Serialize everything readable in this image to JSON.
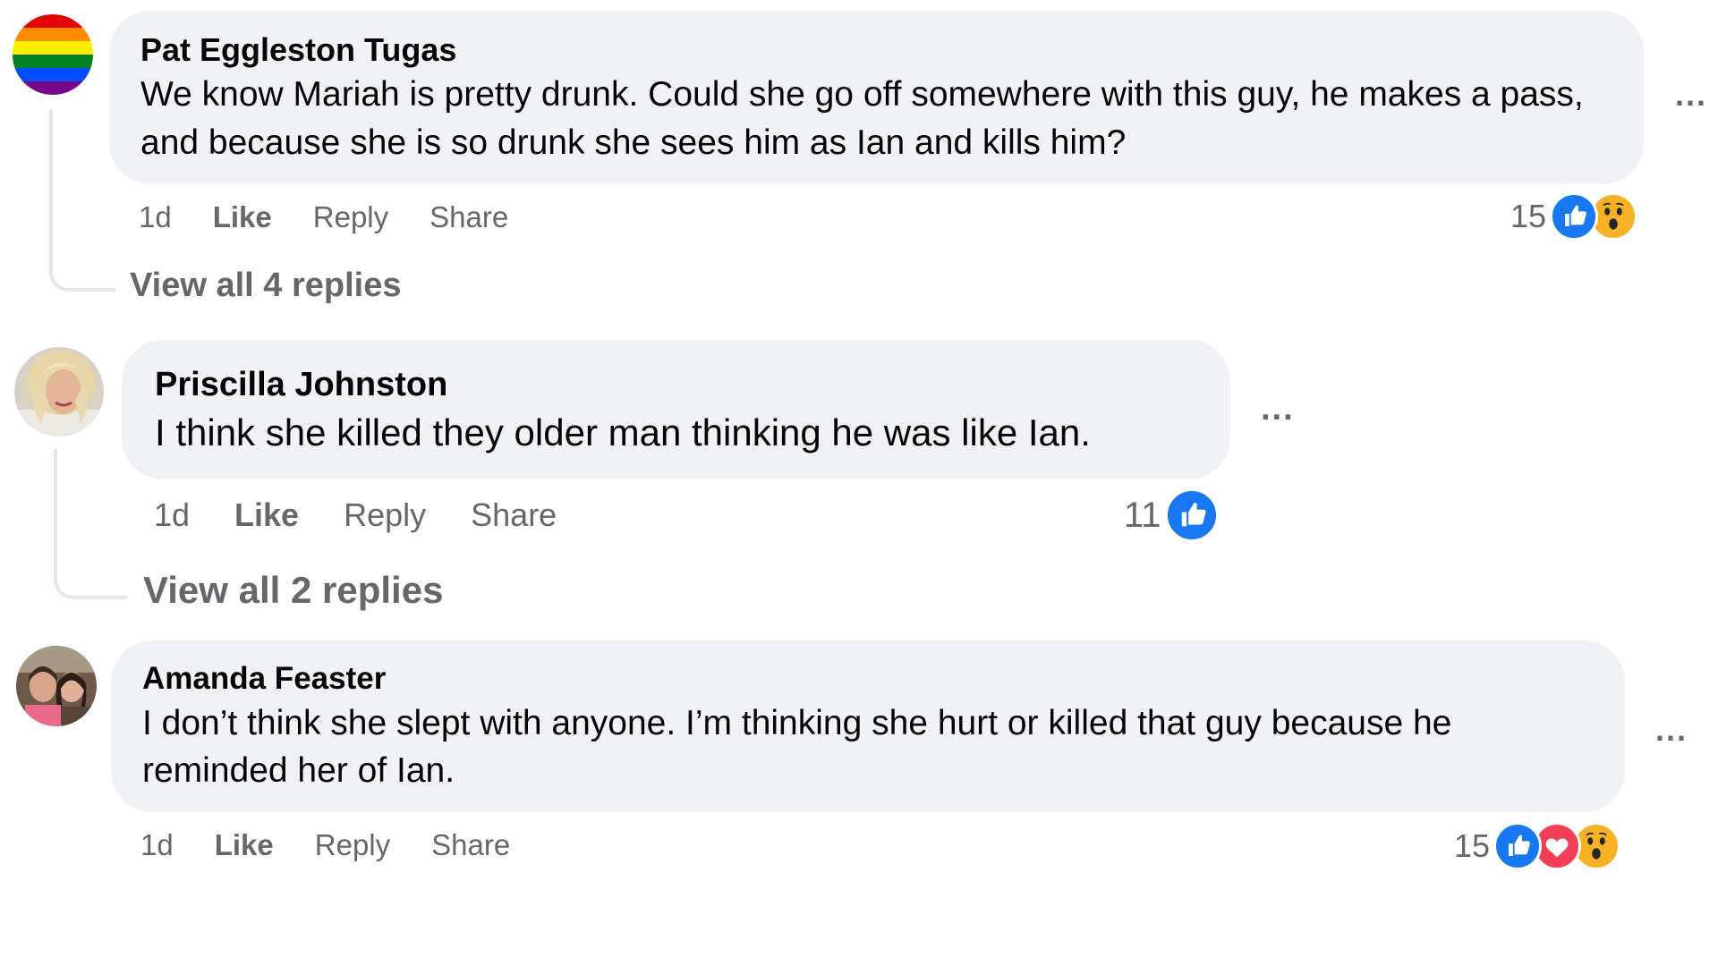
{
  "comments": [
    {
      "author": "Pat Eggleston Tugas",
      "text": "We know Mariah is pretty drunk. Could she go off somewhere with this guy, he makes a pass, and because she is so drunk she sees him as Ian and kills him?",
      "time": "1d",
      "like_label": "Like",
      "reply_label": "Reply",
      "share_label": "Share",
      "more_label": "...",
      "reaction_count": "15",
      "reactions": [
        "like",
        "wow"
      ],
      "view_replies": "View all 4 replies"
    },
    {
      "author": "Priscilla Johnston",
      "text": "I think she killed they older man thinking he was like Ian.",
      "time": "1d",
      "like_label": "Like",
      "reply_label": "Reply",
      "share_label": "Share",
      "more_label": "...",
      "reaction_count": "11",
      "reactions": [
        "like"
      ],
      "view_replies": "View all 2 replies"
    },
    {
      "author": "Amanda Feaster",
      "text": "I don’t think she slept with anyone. I’m thinking she hurt or killed that guy because he reminded her of Ian.",
      "time": "1d",
      "like_label": "Like",
      "reply_label": "Reply",
      "share_label": "Share",
      "more_label": "...",
      "reaction_count": "15",
      "reactions": [
        "like",
        "love",
        "wow"
      ]
    }
  ],
  "colors": {
    "bubble": "#f0f2f5",
    "secondary_text": "#65676b",
    "like_blue": "#1877f2",
    "love_red": "#f33e58",
    "wow_yellow": "#f7b125"
  }
}
